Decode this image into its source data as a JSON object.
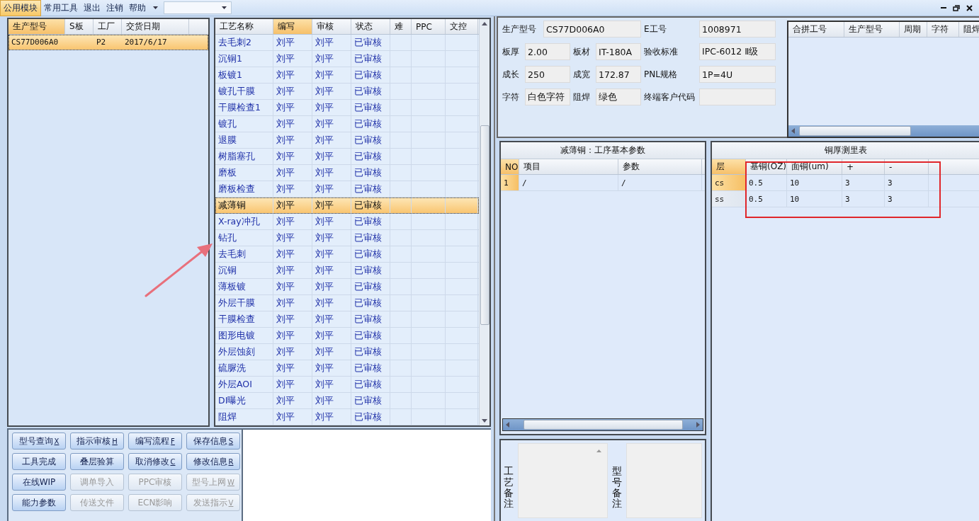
{
  "menu": [
    {
      "label": "公用模块",
      "selected": true
    },
    {
      "label": "常用工具",
      "selected": false
    },
    {
      "label": "退出",
      "selected": false
    },
    {
      "label": "注销",
      "selected": false
    },
    {
      "label": "帮助",
      "selected": false
    }
  ],
  "orders": {
    "columns": [
      {
        "label": "生产型号",
        "selected": true
      },
      {
        "label": "S板",
        "selected": false
      },
      {
        "label": "工厂",
        "selected": false
      },
      {
        "label": "交货日期",
        "selected": false
      }
    ],
    "rows": [
      {
        "model": "CS77D006A0",
        "factory": "P2",
        "date": "2017/6/17",
        "selected": true
      }
    ]
  },
  "process": {
    "columns": [
      {
        "label": "工艺名称",
        "selected": false
      },
      {
        "label": "编写",
        "selected": true
      },
      {
        "label": "审核",
        "selected": false
      },
      {
        "label": "状态",
        "selected": false
      },
      {
        "label": "难",
        "selected": false
      },
      {
        "label": "PPC",
        "selected": false
      },
      {
        "label": "文控",
        "selected": false
      }
    ],
    "rows": [
      {
        "name": "去毛刺2",
        "writer": "刘平",
        "reviewer": "刘平",
        "status": "已审核",
        "selected": false
      },
      {
        "name": "沉铜1",
        "writer": "刘平",
        "reviewer": "刘平",
        "status": "已审核",
        "selected": false
      },
      {
        "name": "板镀1",
        "writer": "刘平",
        "reviewer": "刘平",
        "status": "已审核",
        "selected": false
      },
      {
        "name": "镀孔干膜",
        "writer": "刘平",
        "reviewer": "刘平",
        "status": "已审核",
        "selected": false
      },
      {
        "name": "干膜检查1",
        "writer": "刘平",
        "reviewer": "刘平",
        "status": "已审核",
        "selected": false
      },
      {
        "name": "镀孔",
        "writer": "刘平",
        "reviewer": "刘平",
        "status": "已审核",
        "selected": false
      },
      {
        "name": "退膜",
        "writer": "刘平",
        "reviewer": "刘平",
        "status": "已审核",
        "selected": false
      },
      {
        "name": "树脂塞孔",
        "writer": "刘平",
        "reviewer": "刘平",
        "status": "已审核",
        "selected": false
      },
      {
        "name": "磨板",
        "writer": "刘平",
        "reviewer": "刘平",
        "status": "已审核",
        "selected": false
      },
      {
        "name": "磨板检查",
        "writer": "刘平",
        "reviewer": "刘平",
        "status": "已审核",
        "selected": false
      },
      {
        "name": "减薄铜",
        "writer": "刘平",
        "reviewer": "刘平",
        "status": "已审核",
        "selected": true
      },
      {
        "name": "X-ray冲孔",
        "writer": "刘平",
        "reviewer": "刘平",
        "status": "已审核",
        "selected": false
      },
      {
        "name": "钻孔",
        "writer": "刘平",
        "reviewer": "刘平",
        "status": "已审核",
        "selected": false
      },
      {
        "name": "去毛刺",
        "writer": "刘平",
        "reviewer": "刘平",
        "status": "已审核",
        "selected": false
      },
      {
        "name": "沉铜",
        "writer": "刘平",
        "reviewer": "刘平",
        "status": "已审核",
        "selected": false
      },
      {
        "name": "薄板镀",
        "writer": "刘平",
        "reviewer": "刘平",
        "status": "已审核",
        "selected": false
      },
      {
        "name": "外层干膜",
        "writer": "刘平",
        "reviewer": "刘平",
        "status": "已审核",
        "selected": false
      },
      {
        "name": "干膜检查",
        "writer": "刘平",
        "reviewer": "刘平",
        "status": "已审核",
        "selected": false
      },
      {
        "name": "图形电镀",
        "writer": "刘平",
        "reviewer": "刘平",
        "status": "已审核",
        "selected": false
      },
      {
        "name": "外层蚀刻",
        "writer": "刘平",
        "reviewer": "刘平",
        "status": "已审核",
        "selected": false
      },
      {
        "name": "硫脲洗",
        "writer": "刘平",
        "reviewer": "刘平",
        "status": "已审核",
        "selected": false
      },
      {
        "name": "外层AOI",
        "writer": "刘平",
        "reviewer": "刘平",
        "status": "已审核",
        "selected": false
      },
      {
        "name": "DI曝光",
        "writer": "刘平",
        "reviewer": "刘平",
        "status": "已审核",
        "selected": false
      },
      {
        "name": "阻焊",
        "writer": "刘平",
        "reviewer": "刘平",
        "status": "已审核",
        "selected": false
      }
    ]
  },
  "buttons": [
    {
      "label": "型号查询",
      "key": "X",
      "disabled": false
    },
    {
      "label": "指示审核",
      "key": "H",
      "disabled": false
    },
    {
      "label": "编写流程",
      "key": "F",
      "disabled": false
    },
    {
      "label": "保存信息",
      "key": "S",
      "disabled": false
    },
    {
      "label": "工具完成",
      "disabled": false
    },
    {
      "label": "叠层验算",
      "disabled": false
    },
    {
      "label": "取消修改",
      "key": "C",
      "disabled": false
    },
    {
      "label": "修改信息",
      "key": "R",
      "disabled": false
    },
    {
      "label": "在线WIP",
      "disabled": false
    },
    {
      "label": "调单导入",
      "disabled": true
    },
    {
      "label": "PPC审核",
      "disabled": true
    },
    {
      "label": "型号上网",
      "key": "W",
      "disabled": true
    },
    {
      "label": "能力参数",
      "disabled": false
    },
    {
      "label": "传送文件",
      "disabled": true
    },
    {
      "label": "ECN影响",
      "disabled": true
    },
    {
      "label": "发送指示",
      "key": "V",
      "disabled": true
    }
  ],
  "info": {
    "fields": [
      {
        "label": "生产型号",
        "value": "CS77D006A0"
      },
      {
        "label": "E工号",
        "value": "1008971"
      },
      {
        "label": "板厚",
        "value": "2.00"
      },
      {
        "label": "板材",
        "value": "IT-180A"
      },
      {
        "label": "验收标准",
        "value": "IPC-6012 Ⅱ级"
      },
      {
        "label": "成长",
        "value": "250"
      },
      {
        "label": "成宽",
        "value": "172.87"
      },
      {
        "label": "PNL规格",
        "value": "1P=4U"
      },
      {
        "label": "字符",
        "value": "白色字符"
      },
      {
        "label": "阻焊",
        "value": "绿色"
      },
      {
        "label": "终端客户代码"
      }
    ]
  },
  "merge_table": {
    "columns": [
      "合拼工号",
      "生产型号",
      "周期",
      "字符",
      "阻焊"
    ]
  },
  "thinning": {
    "title": "减薄铜：工序基本参数",
    "columns": [
      "NO",
      "项目",
      "参数"
    ],
    "rows": [
      {
        "no": "1",
        "item": "/",
        "param": "/",
        "selected": true
      }
    ]
  },
  "notes": [
    {
      "label": "工艺备注"
    },
    {
      "label": "型号备注"
    }
  ],
  "copper": {
    "title": "铜厚测里表",
    "columns": [
      "层",
      "基铜(OZ)",
      "面铜(um)",
      "+",
      "-"
    ],
    "rows": [
      {
        "layer": "cs",
        "base": "0.5",
        "surface": "10",
        "plus": "3",
        "minus": "3",
        "selected": true
      },
      {
        "layer": "ss",
        "base": "0.5",
        "surface": "10",
        "plus": "3",
        "minus": "3",
        "selected": false
      }
    ]
  }
}
